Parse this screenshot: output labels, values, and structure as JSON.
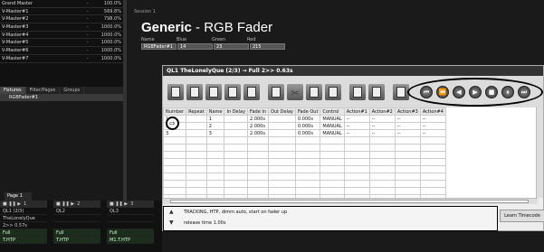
{
  "masters": [
    {
      "name": "Grand Master",
      "dash": "-",
      "value": "100.0%"
    },
    {
      "name": "V-Master#1",
      "dash": "-",
      "value": "569.8%"
    },
    {
      "name": "V-Master#2",
      "dash": "-",
      "value": "798.0%"
    },
    {
      "name": "V-Master#3",
      "dash": "-",
      "value": "1000.0%"
    },
    {
      "name": "V-Master#4",
      "dash": "-",
      "value": "1000.0%"
    },
    {
      "name": "V-Master#5",
      "dash": "-",
      "value": "1000.0%"
    },
    {
      "name": "V-Master#6",
      "dash": "-",
      "value": "1000.0%"
    },
    {
      "name": "V-Master#7",
      "dash": "-",
      "value": "1000.0%"
    }
  ],
  "left_tabs": [
    "Fixtures",
    "Filter/Pages",
    "Groups"
  ],
  "tree": {
    "item": "RGBFader#1"
  },
  "session": "Session 1",
  "fixture": {
    "name_bold": "Generic",
    "name_rest": "- RGB Fader",
    "headers": [
      "Name",
      "Blue",
      "Green",
      "Red"
    ],
    "values": [
      "RGBFader#1",
      "14",
      "23",
      "215"
    ]
  },
  "cue_window": {
    "title": "QL1  TheLonelyQue (2/3)  → Full  2>> 0.63s",
    "columns": [
      "Number",
      "Repeat",
      "Name",
      "In Delay",
      "Fade In",
      "Out Delay",
      "Fade Out",
      "Control",
      "Action#1",
      "Action#2",
      "Action#3",
      "Action#4"
    ],
    "rows": [
      [
        "1",
        "",
        "1",
        "",
        "2.000s",
        "",
        "0.000s",
        "MANUAL",
        "--",
        "--",
        "--",
        "--"
      ],
      [
        "2",
        "",
        "2",
        "",
        "2.000s",
        "",
        "0.000s",
        "MANUAL",
        "--",
        "--",
        "--",
        "--"
      ],
      [
        "3",
        "",
        "3",
        "",
        "2.000s",
        "",
        "0.000s",
        "MANUAL",
        "--",
        "--",
        "--",
        "--"
      ]
    ],
    "info_line1": "TRACKING, HTP, dimm auto, start on fader up",
    "info_line2": "release time 1.00s",
    "timecode_button": "Learn Timecode"
  },
  "toolbar_icons": [
    "new-cue-icon",
    "copy-cue-icon",
    "paste-cue-icon",
    "edit-cue-icon",
    "delete-cue-icon",
    "cue-list-icon",
    "scissors-icon",
    "copy-icon",
    "paste-icon",
    "gear-icon",
    "refresh-icon",
    "monitor-icon"
  ],
  "playback_buttons": [
    "⏮",
    "⏪",
    "◀",
    "▶",
    "■",
    "⏸",
    "⏭"
  ],
  "page_tab": "Page 1",
  "playback": {
    "cols": [
      {
        "num": "1",
        "lines": [
          "QL1 (2/3)",
          "TheLonelyQue",
          "2>> 0.57s",
          "Full",
          "T.HTP"
        ]
      },
      {
        "num": "2",
        "lines": [
          "QL2",
          "",
          "",
          "Full",
          "T.HTP"
        ]
      },
      {
        "num": "3",
        "lines": [
          "QL3",
          "",
          "",
          "Full",
          "M1.T.HTP"
        ]
      }
    ]
  },
  "colors": {
    "panel": "#111111",
    "cue_bg": "#ededed",
    "header_text": "#ffffff"
  }
}
